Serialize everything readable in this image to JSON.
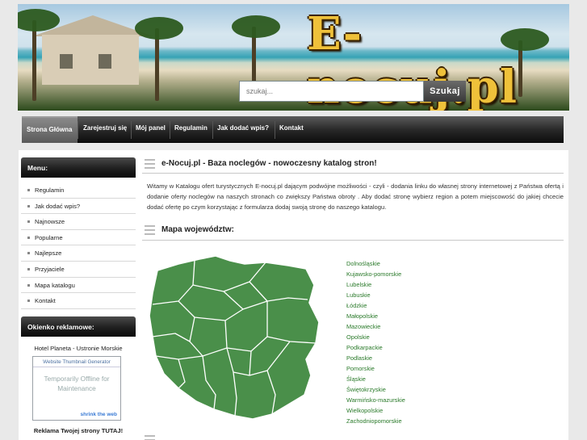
{
  "header": {
    "logo": "E-nocuj.pl",
    "search_placeholder": "szukaj...",
    "search_button": "Szukaj"
  },
  "nav": {
    "items": [
      "Strona Główna",
      "Zarejestruj się",
      "Mój panel",
      "Regulamin",
      "Jak dodać wpis?",
      "Kontakt"
    ]
  },
  "sidebar": {
    "menu_title": "Menu:",
    "menu_items": [
      "Regulamin",
      "Jak dodać wpis?",
      "Najnowsze",
      "Popularne",
      "Najlepsze",
      "Przyjaciele",
      "Mapa katalogu",
      "Kontakt"
    ],
    "ad_title": "Okienko reklamowe:",
    "ad_text": "Hotel Planeta - Ustronie Morskie",
    "thumb_title": "Website Thumbnail Generator",
    "thumb_body": "Temporarily Offline for Maintenance",
    "thumb_logo": "shrink the web",
    "ad_link": "Reklama Twojej strony TUTAJ!"
  },
  "main": {
    "title": "e-Nocuj.pl - Baza noclegów - nowoczesny katalog stron!",
    "intro": "Witamy w Katalogu ofert turystycznych E-nocuj.pl dającym podwójne możliwości - czyli - dodania linku do własnej strony internetowej z Państwa ofertą i dodanie oferty noclegów na naszych stronach co zwiększy Państwa obroty . Aby dodać stronę wybierz region a potem miejscowość do jakiej chcecie dodać ofertę po czym korzystając z formularza dodaj swoją stronę do naszego katalogu.",
    "map_title": "Mapa województw:",
    "regions": [
      "Dolnośląskie",
      "Kujawsko-pomorskie",
      "Lubelskie",
      "Lubuskie",
      "Łódzkie",
      "Małopolskie",
      "Mazowieckie",
      "Opolskie",
      "Podkarpackie",
      "Podlaskie",
      "Pomorskie",
      "Śląskie",
      "Świętokrzyskie",
      "Warmińsko-mazurskie",
      "Wielkopolskie",
      "Zachodniopomorskie"
    ]
  },
  "colors": {
    "map_green": "#4a8f4a",
    "link_green": "#2a7a2a",
    "nav_dark": "#1a1a1a"
  }
}
